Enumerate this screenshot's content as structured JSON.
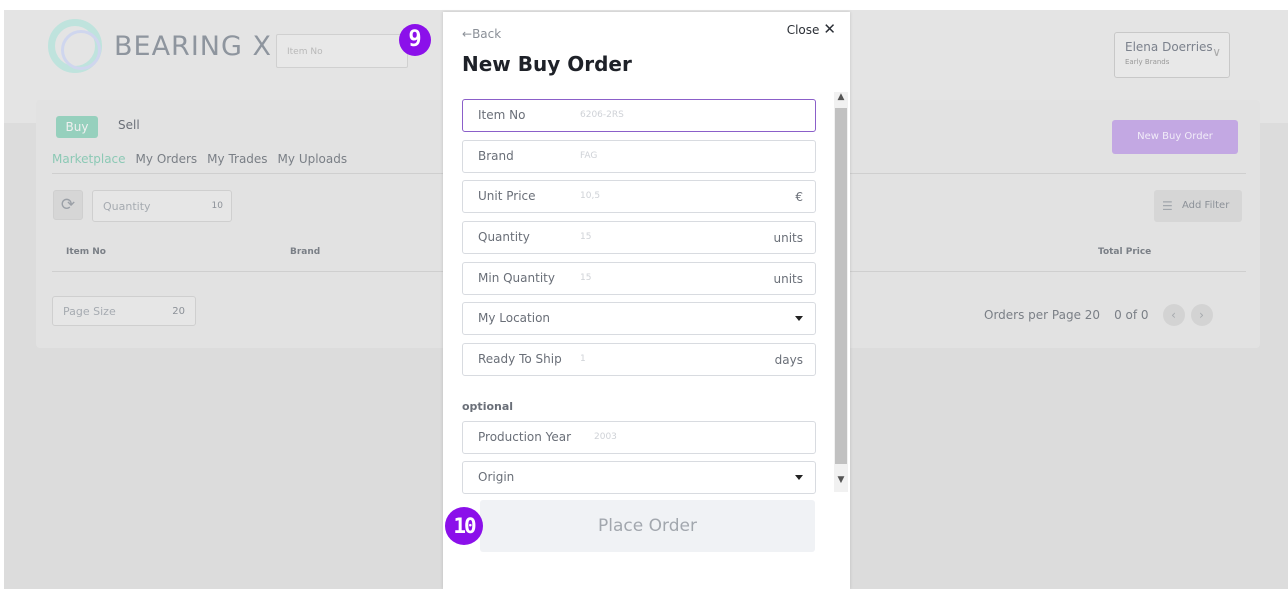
{
  "header": {
    "logo_text": "BEARING X",
    "search_placeholder": "Item No",
    "user_name": "Elena Doerries",
    "user_company": "Early Brands"
  },
  "panel": {
    "buy_label": "Buy",
    "sell_label": "Sell",
    "tabs": [
      "Marketplace",
      "My Orders",
      "My Trades",
      "My Uploads"
    ],
    "new_buy_order_label": "New Buy Order",
    "quantity_filter_label": "Quantity",
    "quantity_filter_value": "10",
    "add_filter_label": "Add Filter",
    "columns": [
      "Item No",
      "Brand",
      "Total Price"
    ],
    "page_size_label": "Page Size",
    "page_size_value": "20",
    "orders_per_page": "Orders per Page 20",
    "range": "0 of 0"
  },
  "modal": {
    "back_label": "Back",
    "close_label": "Close",
    "title": "New Buy Order",
    "fields": [
      {
        "label": "Item No",
        "value": "6206-2RS",
        "unit": ""
      },
      {
        "label": "Brand",
        "value": "FAG",
        "unit": ""
      },
      {
        "label": "Unit Price",
        "value": "10,5",
        "unit": "€"
      },
      {
        "label": "Quantity",
        "value": "15",
        "unit": "units"
      },
      {
        "label": "Min Quantity",
        "value": "15",
        "unit": "units"
      },
      {
        "label": "My Location",
        "value": "",
        "unit": ""
      },
      {
        "label": "Ready To Ship",
        "value": "1",
        "unit": "days"
      }
    ],
    "optional_label": "optional",
    "optional_fields": [
      {
        "label": "Production Year",
        "value": "2003"
      },
      {
        "label": "Origin",
        "value": ""
      }
    ],
    "place_order_label": "Place Order"
  },
  "badges": {
    "step_a": "9",
    "step_b": "10"
  },
  "colors": {
    "accent": "#8b10ea",
    "focus": "#8b5fc9",
    "buy": "#96d0bd",
    "new_order": "#c3a8e3"
  }
}
